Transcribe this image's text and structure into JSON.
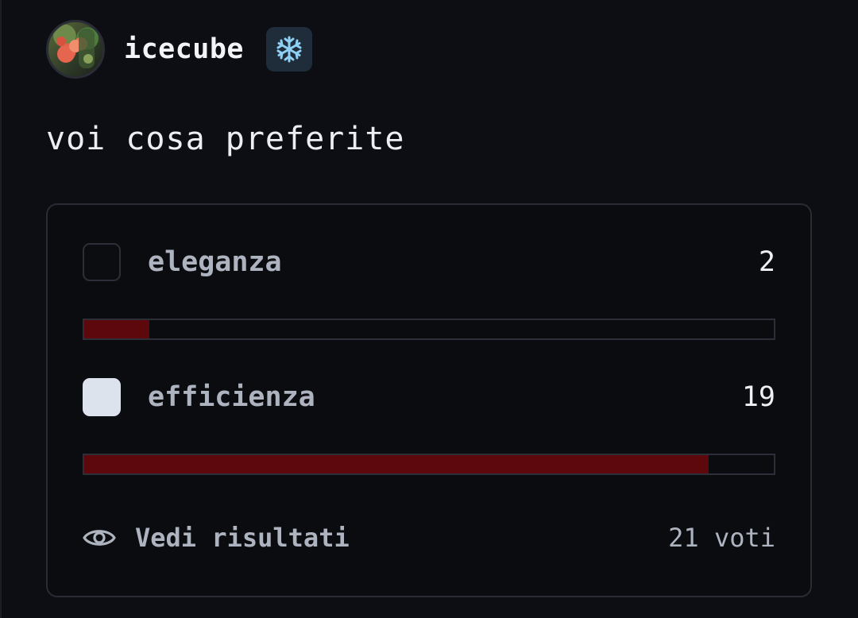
{
  "post": {
    "author": "icecube",
    "badge_icon": "snowflake-icon",
    "text": "voi cosa preferite"
  },
  "poll": {
    "options": [
      {
        "label": "eleganza",
        "votes": "2",
        "share": 0.095,
        "checked": false
      },
      {
        "label": "efficienza",
        "votes": "19",
        "share": 0.905,
        "checked": true
      }
    ],
    "results_label": "Vedi risultati",
    "results_icon": "eye-icon",
    "total_votes": "21 voti",
    "bar_color": "#5c080d"
  }
}
